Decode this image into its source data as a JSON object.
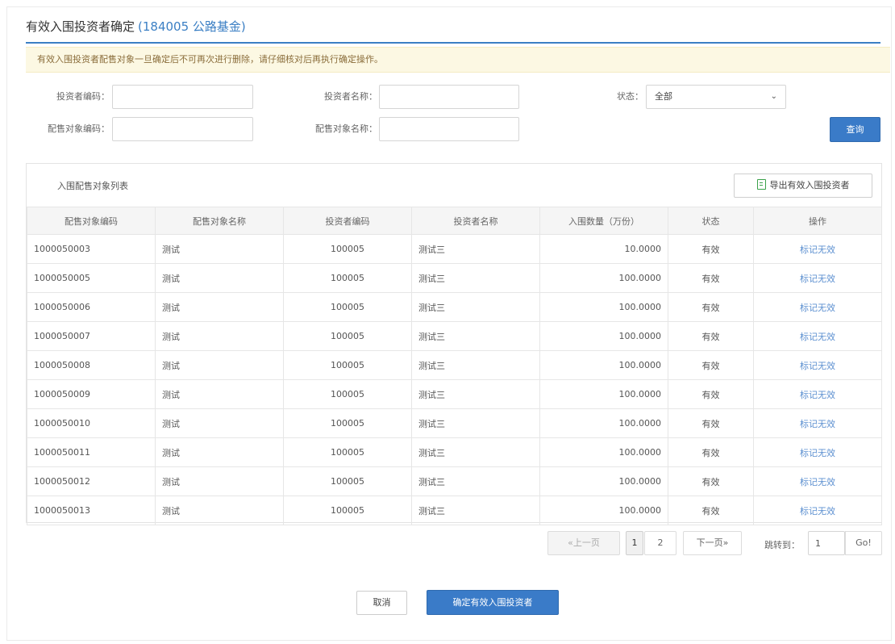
{
  "title": {
    "main": "有效入围投资者确定",
    "sub": "(184005 公路基金)"
  },
  "notice": "有效入围投资者配售对象一旦确定后不可再次进行删除，请仔细核对后再执行确定操作。",
  "filters": {
    "investor_code_label": "投资者编码：",
    "investor_code_value": "",
    "investor_name_label": "投资者名称：",
    "investor_name_value": "",
    "status_label": "状态：",
    "status_value": "全部",
    "placement_code_label": "配售对象编码：",
    "placement_code_value": "",
    "placement_name_label": "配售对象名称：",
    "placement_name_value": "",
    "query_button": "查询"
  },
  "panel": {
    "title": "入围配售对象列表",
    "export_button": "导出有效入围投资者",
    "columns": [
      "配售对象编码",
      "配售对象名称",
      "投资者编码",
      "投资者名称",
      "入围数量（万份）",
      "状态",
      "操作"
    ],
    "rows": [
      {
        "code": "1000050003",
        "name": "测试",
        "investor_code": "100005",
        "investor_name": "测试三",
        "quantity": "10.0000",
        "status": "有效",
        "action": "标记无效"
      },
      {
        "code": "1000050005",
        "name": "测试",
        "investor_code": "100005",
        "investor_name": "测试三",
        "quantity": "100.0000",
        "status": "有效",
        "action": "标记无效"
      },
      {
        "code": "1000050006",
        "name": "测试",
        "investor_code": "100005",
        "investor_name": "测试三",
        "quantity": "100.0000",
        "status": "有效",
        "action": "标记无效"
      },
      {
        "code": "1000050007",
        "name": "测试",
        "investor_code": "100005",
        "investor_name": "测试三",
        "quantity": "100.0000",
        "status": "有效",
        "action": "标记无效"
      },
      {
        "code": "1000050008",
        "name": "测试",
        "investor_code": "100005",
        "investor_name": "测试三",
        "quantity": "100.0000",
        "status": "有效",
        "action": "标记无效"
      },
      {
        "code": "1000050009",
        "name": "测试",
        "investor_code": "100005",
        "investor_name": "测试三",
        "quantity": "100.0000",
        "status": "有效",
        "action": "标记无效"
      },
      {
        "code": "1000050010",
        "name": "测试",
        "investor_code": "100005",
        "investor_name": "测试三",
        "quantity": "100.0000",
        "status": "有效",
        "action": "标记无效"
      },
      {
        "code": "1000050011",
        "name": "测试",
        "investor_code": "100005",
        "investor_name": "测试三",
        "quantity": "100.0000",
        "status": "有效",
        "action": "标记无效"
      },
      {
        "code": "1000050012",
        "name": "测试",
        "investor_code": "100005",
        "investor_name": "测试三",
        "quantity": "100.0000",
        "status": "有效",
        "action": "标记无效"
      },
      {
        "code": "1000050013",
        "name": "测试",
        "investor_code": "100005",
        "investor_name": "测试三",
        "quantity": "100.0000",
        "status": "有效",
        "action": "标记无效"
      }
    ]
  },
  "pagination": {
    "prev": "«上一页",
    "pages": [
      "1",
      "2"
    ],
    "current_page": "1",
    "next": "下一页»",
    "jump_label": "跳转到：",
    "jump_value": "1",
    "go": "Go!"
  },
  "footer": {
    "cancel_button": "取消",
    "confirm_button": "确定有效入围投资者"
  },
  "colors": {
    "accent": "#3a7bc8",
    "status_valid": "#f0ad4e",
    "link": "#5b8fd0",
    "notice_bg": "#fcf8e3"
  }
}
